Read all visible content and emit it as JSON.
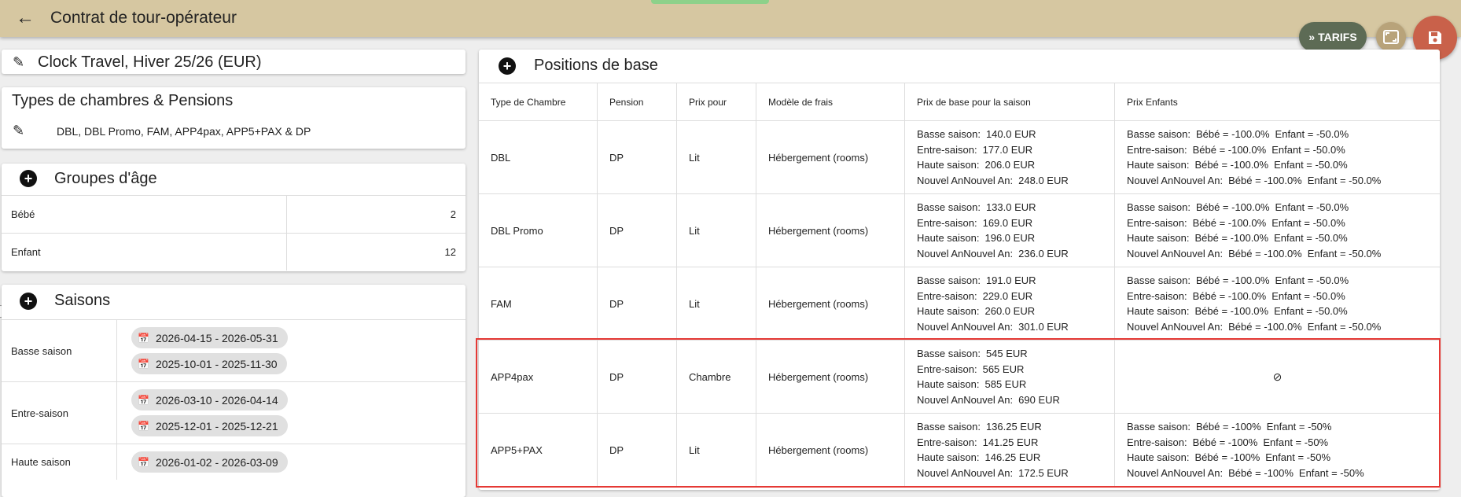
{
  "header": {
    "title": "Contrat de tour-opérateur",
    "back_icon": "arrow-left-icon"
  },
  "actions": {
    "tarifs_label": "TARIFS"
  },
  "contract": {
    "name": "Clock Travel, Hiver 25/26 (EUR)"
  },
  "rooms": {
    "title": "Types de chambres & Pensions",
    "list": "DBL, DBL Promo, FAM, APP4pax, APP5+PAX & DP"
  },
  "age_groups": {
    "title": "Groupes d'âge",
    "rows": [
      {
        "label": "Bébé",
        "value": "2"
      },
      {
        "label": "Enfant",
        "value": "12"
      }
    ]
  },
  "seasons": {
    "title": "Saisons",
    "rows": [
      {
        "label": "Basse saison",
        "chips": [
          "2026-04-15 - 2026-05-31",
          "2025-10-01 - 2025-11-30"
        ]
      },
      {
        "label": "Entre-saison",
        "chips": [
          "2026-03-10 - 2026-04-14",
          "2025-12-01 - 2025-12-21"
        ]
      },
      {
        "label": "Haute saison",
        "chips": [
          "2026-01-02 - 2026-03-09"
        ]
      }
    ]
  },
  "positions": {
    "title": "Positions de base",
    "headers": [
      "Type de Chambre",
      "Pension",
      "Prix pour",
      "Modèle de frais",
      "Prix de base pour la saison",
      "Prix Enfants"
    ],
    "rows": [
      {
        "room": "DBL",
        "pension": "DP",
        "price_for": "Lit",
        "model": "Hébergement (rooms)",
        "prices": [
          [
            "Basse saison:",
            "140.0 EUR"
          ],
          [
            "Entre-saison:",
            "177.0 EUR"
          ],
          [
            "Haute saison:",
            "206.0 EUR"
          ],
          [
            "Nouvel AnNouvel An:",
            "248.0 EUR"
          ]
        ],
        "children": [
          [
            "Basse saison:",
            "Bébé = -100.0%",
            "Enfant = -50.0%"
          ],
          [
            "Entre-saison:",
            "Bébé = -100.0%",
            "Enfant = -50.0%"
          ],
          [
            "Haute saison:",
            "Bébé = -100.0%",
            "Enfant = -50.0%"
          ],
          [
            "Nouvel AnNouvel An:",
            "Bébé = -100.0%",
            "Enfant = -50.0%"
          ]
        ]
      },
      {
        "room": "DBL Promo",
        "pension": "DP",
        "price_for": "Lit",
        "model": "Hébergement (rooms)",
        "prices": [
          [
            "Basse saison:",
            "133.0 EUR"
          ],
          [
            "Entre-saison:",
            "169.0 EUR"
          ],
          [
            "Haute saison:",
            "196.0 EUR"
          ],
          [
            "Nouvel AnNouvel An:",
            "236.0 EUR"
          ]
        ],
        "children": [
          [
            "Basse saison:",
            "Bébé = -100.0%",
            "Enfant = -50.0%"
          ],
          [
            "Entre-saison:",
            "Bébé = -100.0%",
            "Enfant = -50.0%"
          ],
          [
            "Haute saison:",
            "Bébé = -100.0%",
            "Enfant = -50.0%"
          ],
          [
            "Nouvel AnNouvel An:",
            "Bébé = -100.0%",
            "Enfant = -50.0%"
          ]
        ]
      },
      {
        "room": "FAM",
        "pension": "DP",
        "price_for": "Lit",
        "model": "Hébergement (rooms)",
        "prices": [
          [
            "Basse saison:",
            "191.0 EUR"
          ],
          [
            "Entre-saison:",
            "229.0 EUR"
          ],
          [
            "Haute saison:",
            "260.0 EUR"
          ],
          [
            "Nouvel AnNouvel An:",
            "301.0 EUR"
          ]
        ],
        "children": [
          [
            "Basse saison:",
            "Bébé = -100.0%",
            "Enfant = -50.0%"
          ],
          [
            "Entre-saison:",
            "Bébé = -100.0%",
            "Enfant = -50.0%"
          ],
          [
            "Haute saison:",
            "Bébé = -100.0%",
            "Enfant = -50.0%"
          ],
          [
            "Nouvel AnNouvel An:",
            "Bébé = -100.0%",
            "Enfant = -50.0%"
          ]
        ]
      },
      {
        "room": "APP4pax",
        "pension": "DP",
        "price_for": "Chambre",
        "model": "Hébergement (rooms)",
        "prices": [
          [
            "Basse saison:",
            "545 EUR"
          ],
          [
            "Entre-saison:",
            "565 EUR"
          ],
          [
            "Haute saison:",
            "585 EUR"
          ],
          [
            "Nouvel AnNouvel An:",
            "690 EUR"
          ]
        ],
        "children": [],
        "children_empty": "⊘"
      },
      {
        "room": "APP5+PAX",
        "pension": "DP",
        "price_for": "Lit",
        "model": "Hébergement (rooms)",
        "prices": [
          [
            "Basse saison:",
            "136.25 EUR"
          ],
          [
            "Entre-saison:",
            "141.25 EUR"
          ],
          [
            "Haute saison:",
            "146.25 EUR"
          ],
          [
            "Nouvel AnNouvel An:",
            "172.5 EUR"
          ]
        ],
        "children": [
          [
            "Basse saison:",
            "Bébé = -100%",
            "Enfant = -50%"
          ],
          [
            "Entre-saison:",
            "Bébé = -100%",
            "Enfant = -50%"
          ],
          [
            "Haute saison:",
            "Bébé = -100%",
            "Enfant = -50%"
          ],
          [
            "Nouvel AnNouvel An:",
            "Bébé = -100%",
            "Enfant = -50%"
          ]
        ]
      }
    ]
  }
}
